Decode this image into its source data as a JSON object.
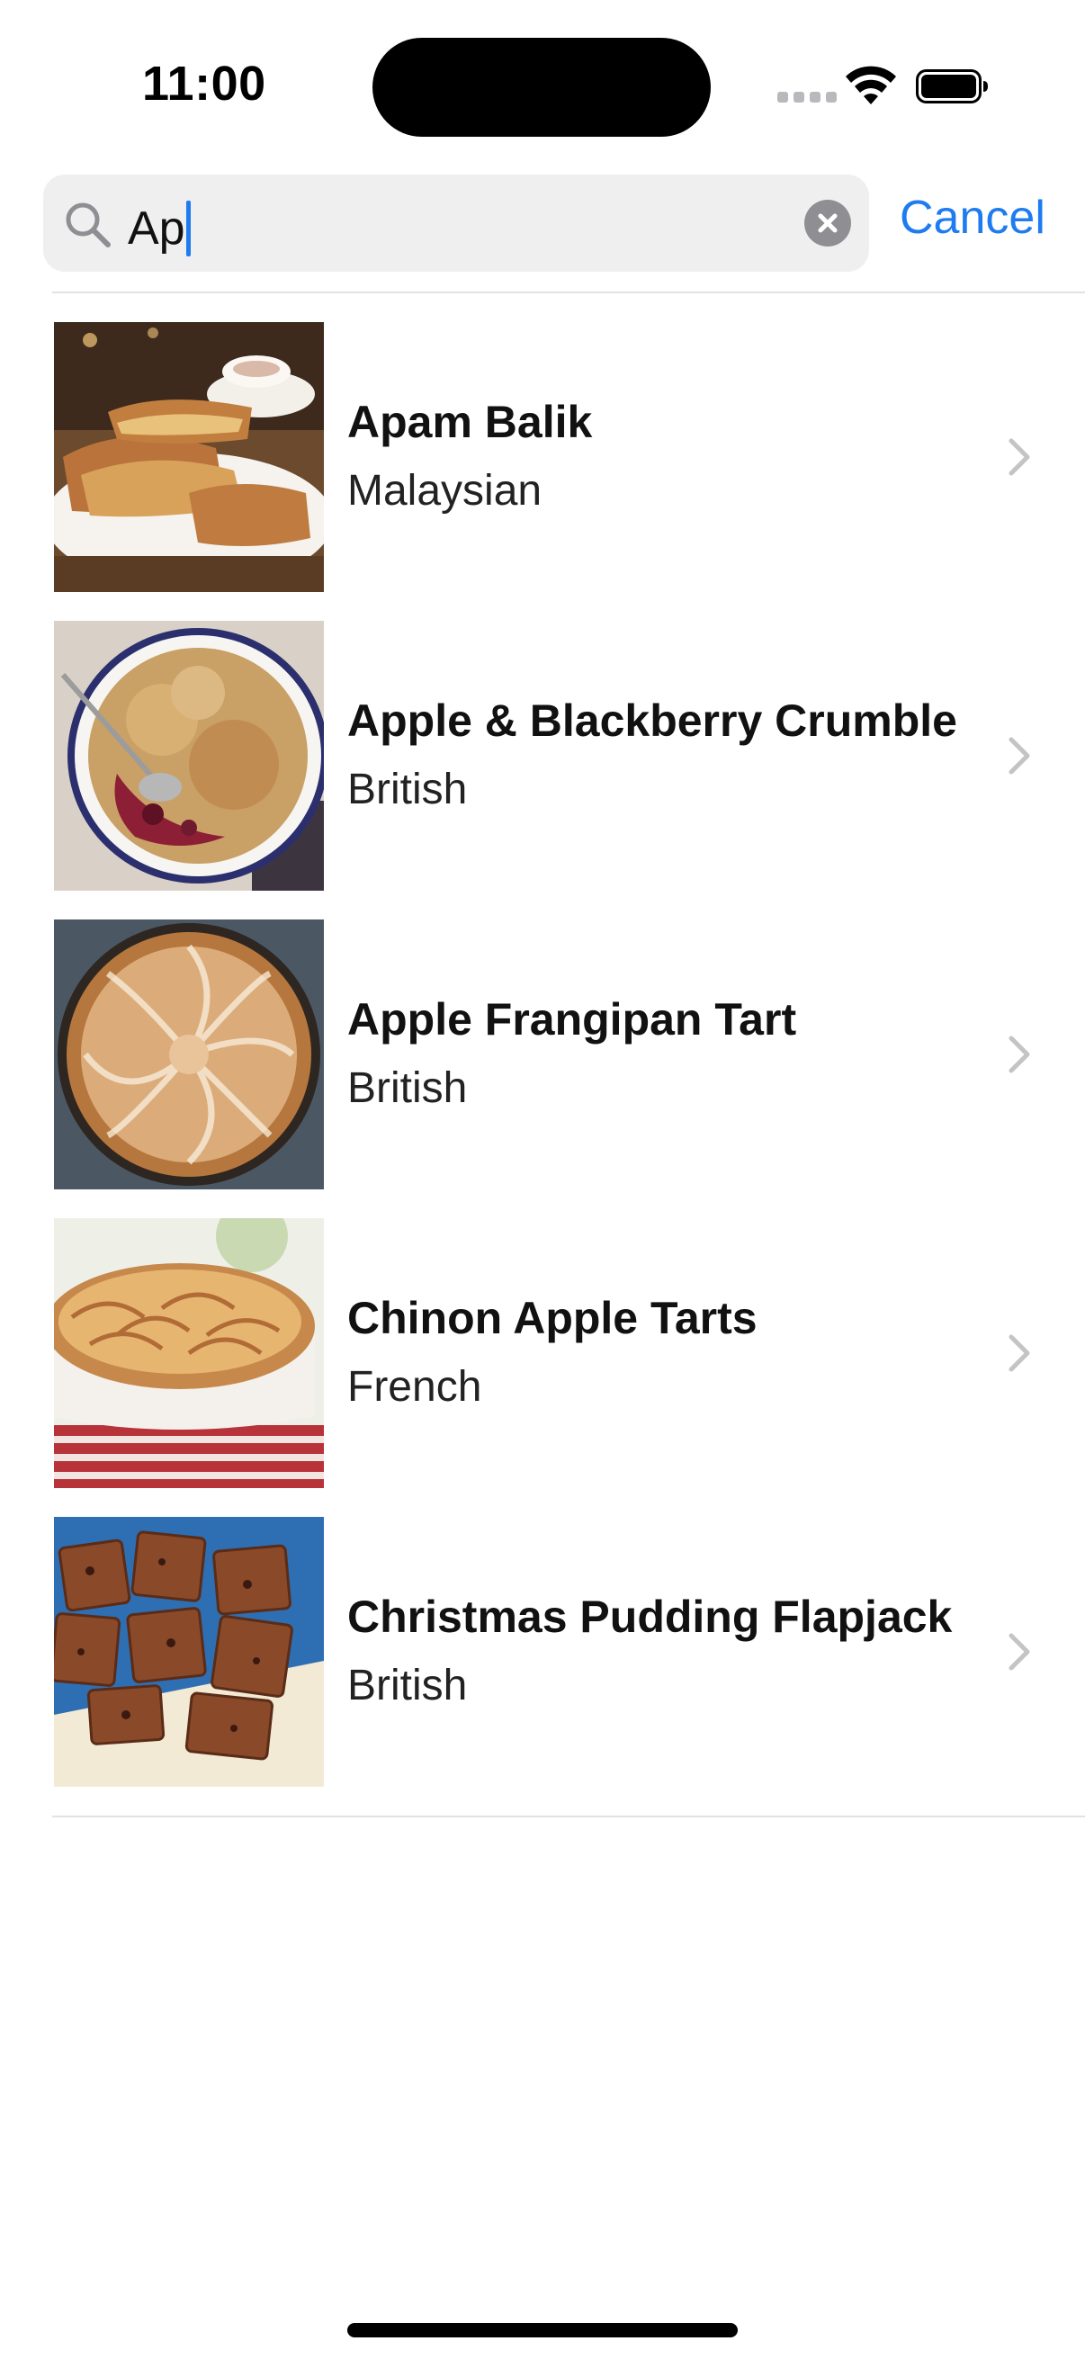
{
  "status_bar": {
    "time": "11:00",
    "signal_icon": "cellular-signal-icon",
    "wifi_icon": "wifi-icon",
    "battery_icon": "battery-icon"
  },
  "search": {
    "value": "Ap",
    "icon": "search-icon",
    "clear_icon": "clear-icon",
    "cancel_label": "Cancel"
  },
  "colors": {
    "accent": "#1f7bf0",
    "field_background": "#efeff0",
    "divider": "#e2e2e4",
    "chevron": "#c4c4c7"
  },
  "results": [
    {
      "title": "Apam Balik",
      "subtitle": "Malaysian",
      "image": "apam-balik-image"
    },
    {
      "title": "Apple & Blackberry Crumble",
      "subtitle": "British",
      "image": "apple-blackberry-crumble-image"
    },
    {
      "title": "Apple Frangipan Tart",
      "subtitle": "British",
      "image": "apple-frangipan-tart-image"
    },
    {
      "title": "Chinon Apple Tarts",
      "subtitle": "French",
      "image": "chinon-apple-tarts-image"
    },
    {
      "title": "Christmas Pudding Flapjack",
      "subtitle": "British",
      "image": "christmas-pudding-flapjack-image"
    }
  ]
}
